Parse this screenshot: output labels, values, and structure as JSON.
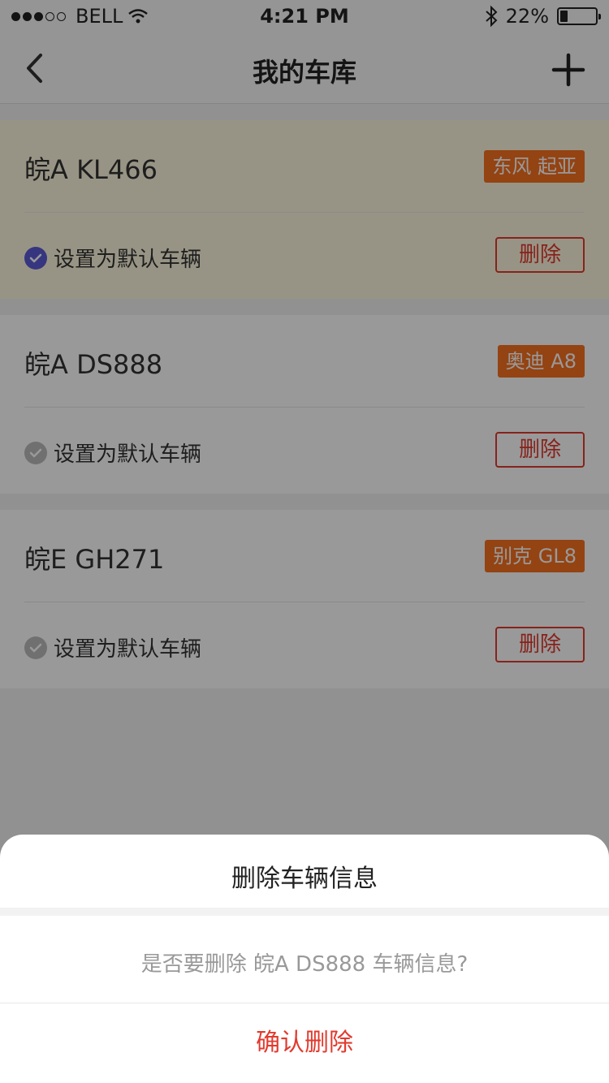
{
  "status_bar": {
    "carrier": "BELL",
    "time": "4:21 PM",
    "battery_percent": "22%",
    "battery_level": 0.22,
    "icons": [
      "signal-dots-icon",
      "wifi-icon",
      "bluetooth-icon",
      "battery-icon"
    ]
  },
  "nav": {
    "title": "我的车库",
    "back_icon": "chevron-left-icon",
    "add_icon": "plus-icon"
  },
  "vehicles": [
    {
      "plate": "皖A KL466",
      "brand": "东风 起亚",
      "default_label": "设置为默认车辆",
      "is_default": true,
      "delete_label": "删除"
    },
    {
      "plate": "皖A DS888",
      "brand": "奥迪 A8",
      "default_label": "设置为默认车辆",
      "is_default": false,
      "delete_label": "删除"
    },
    {
      "plate": "皖E GH271",
      "brand": "别克 GL8",
      "default_label": "设置为默认车辆",
      "is_default": false,
      "delete_label": "删除"
    }
  ],
  "dialog": {
    "title": "删除车辆信息",
    "message": "是否要删除 皖A DS888 车辆信息?",
    "confirm_label": "确认删除"
  },
  "colors": {
    "accent": "#f7701f",
    "danger": "#e23a2e",
    "check_on": "#5b5bd6",
    "selected_card": "#fdf7de"
  }
}
